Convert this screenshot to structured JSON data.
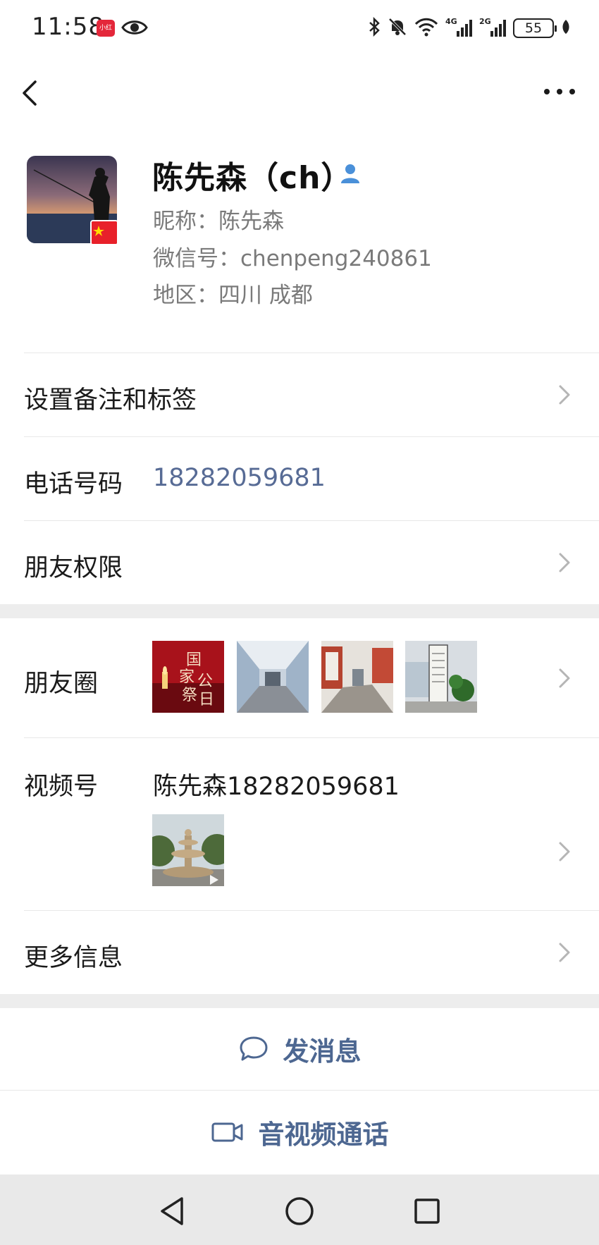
{
  "status_bar": {
    "time": "11:58",
    "app_badge": "小红书",
    "signal_1": "4G",
    "signal_2": "2G",
    "battery": "55"
  },
  "profile": {
    "name": "陈先森（ch）",
    "nickname": "昵称：陈先森",
    "wechat_id": "微信号：chenpeng240861",
    "region": "地区：四川  成都"
  },
  "rows": {
    "remark_label": "设置备注和标签",
    "phone_label": "电话号码",
    "phone_value": "18282059681",
    "permission_label": "朋友权限",
    "moments_label": "朋友圈",
    "channels_label": "视频号",
    "channels_value": "陈先森18282059681",
    "more_label": "更多信息"
  },
  "actions": {
    "message_label": "发消息",
    "call_label": "音视频通话"
  },
  "colors": {
    "link": "#576b95",
    "accent_blue": "#4a90d9",
    "gap": "#ededed"
  }
}
